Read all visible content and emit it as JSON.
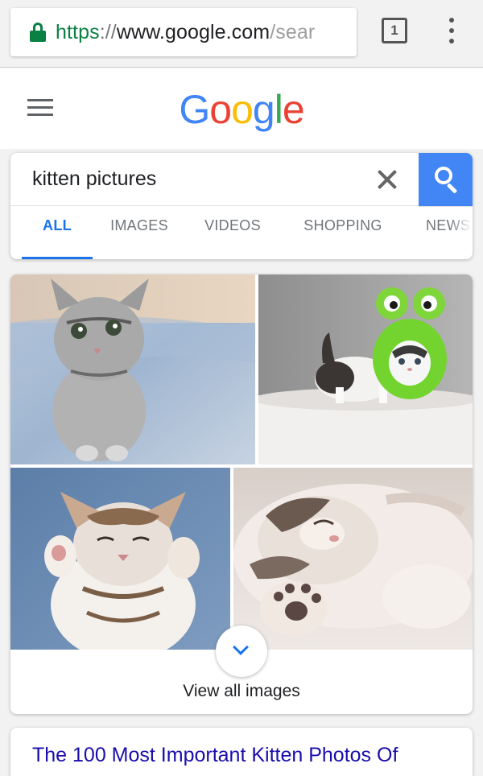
{
  "browser": {
    "url_scheme": "https",
    "url_separator": "://",
    "url_host": "www.google.com",
    "url_path": "/sear",
    "tab_count": "1"
  },
  "header": {
    "logo_letters": [
      {
        "char": "G",
        "color": "#4285f4"
      },
      {
        "char": "o",
        "color": "#ea4335"
      },
      {
        "char": "o",
        "color": "#fbbc05"
      },
      {
        "char": "g",
        "color": "#4285f4"
      },
      {
        "char": "l",
        "color": "#34a853"
      },
      {
        "char": "e",
        "color": "#ea4335"
      }
    ]
  },
  "search": {
    "query": "kitten pictures",
    "tabs": [
      {
        "label": "ALL",
        "active": true
      },
      {
        "label": "IMAGES",
        "active": false
      },
      {
        "label": "VIDEOS",
        "active": false
      },
      {
        "label": "SHOPPING",
        "active": false
      },
      {
        "label": "NEWS",
        "active": false
      }
    ]
  },
  "images": {
    "thumbnails": [
      {
        "subject": "grey tabby kitten sitting on blue blanket"
      },
      {
        "subject": "kitten wearing green frog hat"
      },
      {
        "subject": "tabby kitten stretching with eyes closed on jeans"
      },
      {
        "subject": "sleeping kitten lying on its back"
      }
    ],
    "view_all_label": "View all images"
  },
  "results": {
    "first_title": "The 100 Most Important Kitten Photos Of"
  },
  "colors": {
    "accent": "#1a73e8",
    "search_button": "#4285f4",
    "secure": "#0b8043"
  }
}
